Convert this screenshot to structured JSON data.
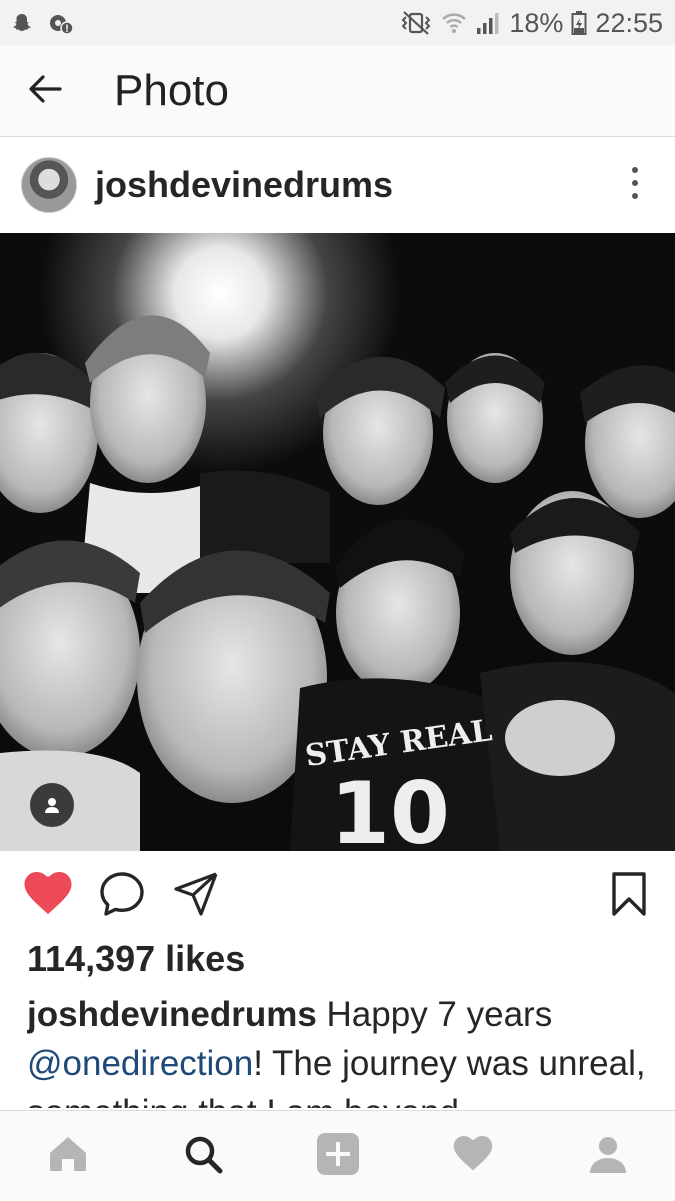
{
  "status_bar": {
    "battery": "18%",
    "time": "22:55"
  },
  "app_bar": {
    "title": "Photo"
  },
  "post": {
    "username": "joshdevinedrums",
    "photo_shirt_text": "STAY REAL",
    "photo_shirt_number": "10",
    "likes": "114,397 likes",
    "caption_user": "joshdevinedrums",
    "caption_text_1": " Happy 7 years ",
    "caption_mention": "@onedirection",
    "caption_text_2": "! The journey was unreal, something that I am beyond"
  },
  "icons": {
    "status_left": [
      "snapchat-icon",
      "location-settings-icon"
    ],
    "status_right": [
      "vibrate-icon",
      "wifi-icon",
      "signal-icon",
      "battery-icon"
    ],
    "actions": [
      "heart-icon",
      "comment-icon",
      "share-icon",
      "bookmark-icon"
    ],
    "bottom_nav": [
      "home-icon",
      "search-icon",
      "add-icon",
      "heart-icon",
      "profile-icon"
    ]
  },
  "colors": {
    "like_active": "#ed4956",
    "mention": "#1e4a7a",
    "nav_active": "#262626",
    "nav_inactive": "#b5b5b5"
  }
}
